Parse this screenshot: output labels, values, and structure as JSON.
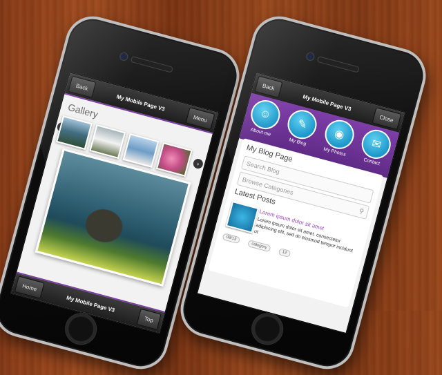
{
  "left_phone": {
    "header": {
      "back_label": "Back",
      "title": "My Mobile Page V3",
      "menu_label": "Menu"
    },
    "gallery_title": "Gallery",
    "footer": {
      "home_label": "Home",
      "title": "My Mobile Page V3",
      "top_label": "Top"
    }
  },
  "right_phone": {
    "header": {
      "back_label": "Back",
      "title": "My Mobile Page V3",
      "close_label": "Close"
    },
    "menu": [
      {
        "label": "About me",
        "icon": "person-icon"
      },
      {
        "label": "My Blog",
        "icon": "chat-icon"
      },
      {
        "label": "My Photos",
        "icon": "camera-icon"
      },
      {
        "label": "Contact",
        "icon": "envelope-icon"
      }
    ],
    "blog_page_title": "My Blog Page",
    "search_placeholder": "Search Blog",
    "categories_placeholder": "Browse Categories",
    "latest_posts_title": "Latest Posts",
    "post": {
      "title": "Lorem ipsum dolor sit amet",
      "body": "Lorem ipsum dolor sit amet, consectetur adipiscing elit, sed do eiusmod tempor incidunt ut",
      "tags": [
        "08/13",
        "category",
        "12"
      ]
    }
  }
}
